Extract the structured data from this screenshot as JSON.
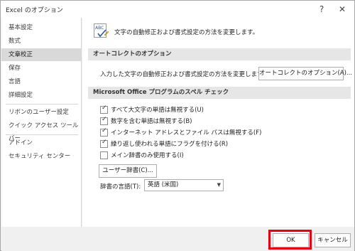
{
  "window": {
    "title": "Excel のオプション",
    "help_glyph": "?",
    "close_glyph": "✕"
  },
  "sidebar": {
    "items": [
      {
        "label": "基本設定"
      },
      {
        "label": "数式"
      },
      {
        "label": "文章校正",
        "selected": true
      },
      {
        "label": "保存"
      },
      {
        "label": "言語"
      },
      {
        "label": "詳細設定"
      },
      {
        "label": "リボンのユーザー設定"
      },
      {
        "label": "クイック アクセス ツール バー"
      },
      {
        "label": "アドイン"
      },
      {
        "label": "セキュリティ センター"
      }
    ]
  },
  "main": {
    "header": "文字の自動修正および書式設定の方法を変更します。",
    "icon_text": "ABC",
    "autocorrect": {
      "section_title": "オートコレクトのオプション",
      "description": "入力した文字の自動修正および書式設定の方法を変更します:",
      "button_label": "オートコレクトのオプション(A)..."
    },
    "spelling": {
      "section_title": "Microsoft Office プログラムのスペル チェック",
      "options": [
        {
          "label": "すべて大文字の単語は無視する(U)",
          "checked": true
        },
        {
          "label": "数字を含む単語は無視する(B)",
          "checked": true
        },
        {
          "label": "インターネット アドレスとファイル パスは無視する(F)",
          "checked": true
        },
        {
          "label": "繰り返し使われる単語にフラグを付ける(R)",
          "checked": true
        },
        {
          "label": "メイン辞書のみ使用する(I)",
          "checked": false
        }
      ],
      "custom_dict_button": "ユーザー辞書(C)...",
      "dict_lang_label": "辞書の言語(T):",
      "dict_lang_value": "英語 (米国)",
      "check_glyph": "✓",
      "caret_glyph": "▼"
    }
  },
  "footer": {
    "ok_label": "OK",
    "cancel_label": "キャンセル"
  },
  "colors": {
    "highlight": "#e60012",
    "selected_nav": "#d9d9d9",
    "section_bar": "#e6e6e6"
  }
}
